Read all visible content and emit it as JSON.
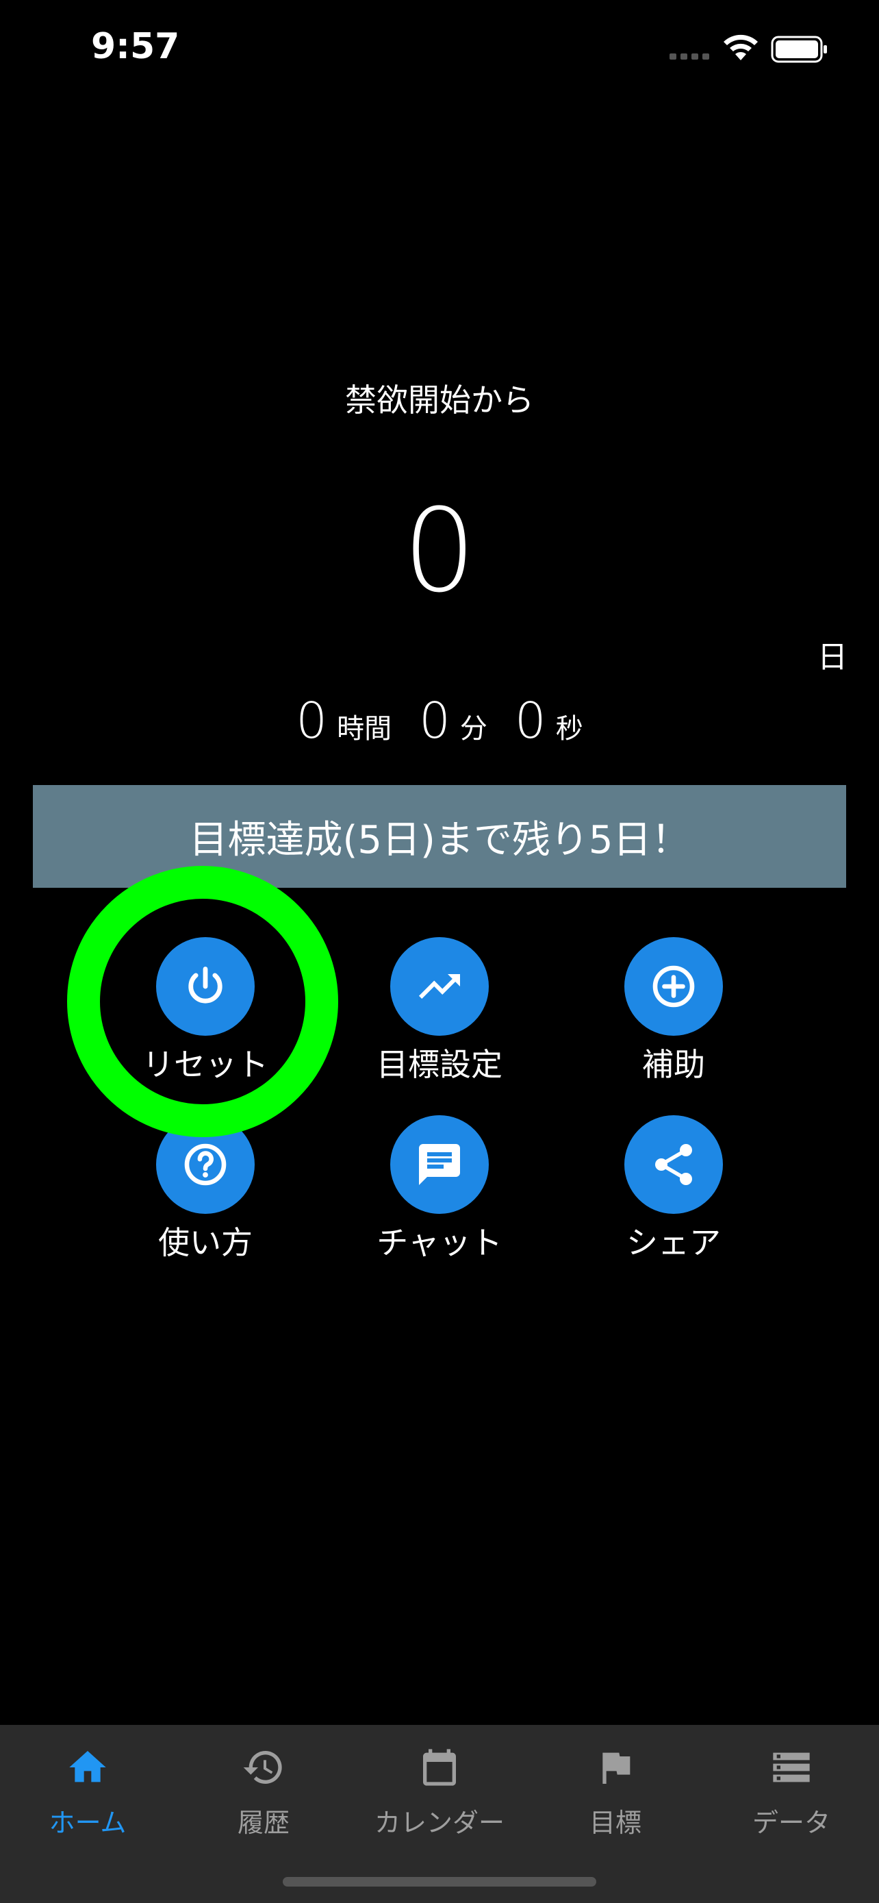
{
  "status_bar": {
    "time": "9:57"
  },
  "hero": {
    "title": "禁欲開始から",
    "days": "0",
    "day_unit": "日",
    "hours": "0",
    "hours_unit": "時間",
    "minutes": "0",
    "minutes_unit": "分",
    "seconds": "0",
    "seconds_unit": "秒"
  },
  "goal_banner": {
    "text": "目標達成(5日)まで残り5日！"
  },
  "actions": [
    {
      "label": "リセット",
      "icon": "power-icon"
    },
    {
      "label": "目標設定",
      "icon": "trending-up-icon"
    },
    {
      "label": "補助",
      "icon": "add-circle-icon"
    },
    {
      "label": "使い方",
      "icon": "help-icon"
    },
    {
      "label": "チャット",
      "icon": "chat-icon"
    },
    {
      "label": "シェア",
      "icon": "share-icon"
    }
  ],
  "tabs": [
    {
      "label": "ホーム",
      "icon": "home-icon",
      "active": true
    },
    {
      "label": "履歴",
      "icon": "history-icon",
      "active": false
    },
    {
      "label": "カレンダー",
      "icon": "calendar-icon",
      "active": false
    },
    {
      "label": "目標",
      "icon": "flag-icon",
      "active": false
    },
    {
      "label": "データ",
      "icon": "storage-icon",
      "active": false
    }
  ],
  "colors": {
    "background": "#000000",
    "accent": "#1e88e5",
    "active_tab": "#2196f3",
    "banner": "#607d8b",
    "highlight": "#00ff00",
    "tab_bar": "#2b2b2b"
  }
}
